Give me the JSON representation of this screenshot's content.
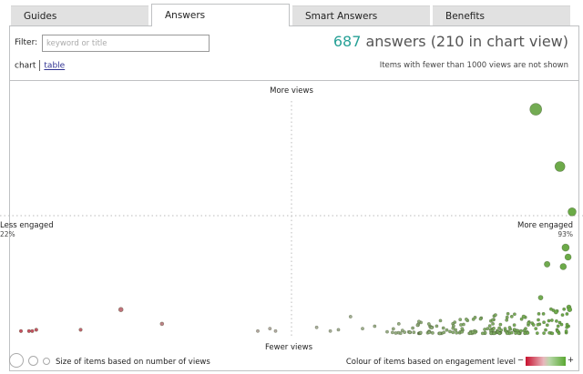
{
  "tabs": [
    {
      "label": "Guides",
      "active": false
    },
    {
      "label": "Answers",
      "active": true
    },
    {
      "label": "Smart Answers",
      "active": false
    },
    {
      "label": "Benefits",
      "active": false
    }
  ],
  "filter": {
    "label": "Filter:",
    "placeholder": "keyword or title",
    "value": ""
  },
  "summary": {
    "count": "687",
    "text": " answers (210 in chart view)"
  },
  "view_toggle": {
    "current": "chart",
    "other": "table"
  },
  "note": "Items with fewer than 1000 views are not shown",
  "axes": {
    "top": "More views",
    "bottom": "Fewer views",
    "left": "Less engaged",
    "left_value": "22%",
    "right": "More engaged",
    "right_value": "93%"
  },
  "legend": {
    "size_text": "Size of items based on number of views",
    "colour_text": "Colour of items based on engagement level",
    "minus": "−",
    "plus": "+"
  },
  "colors": {
    "accent": "#28a197",
    "low_engagement": "#c8102e",
    "high_engagement": "#5aa832",
    "link": "#2e3191"
  },
  "chart_data": {
    "type": "scatter",
    "x_label_left": "Less engaged",
    "x_label_right": "More engaged",
    "y_label_top": "More views",
    "y_label_bottom": "Fewer views",
    "xlim_percent": [
      22,
      93
    ],
    "points": [
      {
        "engagement": 88.5,
        "views": 95,
        "r": 6.5
      },
      {
        "engagement": 91.5,
        "views": 71,
        "r": 5.5
      },
      {
        "engagement": 93.0,
        "views": 52,
        "r": 4.5
      },
      {
        "engagement": 92.2,
        "views": 37,
        "r": 4.0
      },
      {
        "engagement": 92.5,
        "views": 33,
        "r": 3.5
      },
      {
        "engagement": 91.9,
        "views": 29,
        "r": 3.5
      },
      {
        "engagement": 89.9,
        "views": 30,
        "r": 3.2
      },
      {
        "engagement": 89.1,
        "views": 16,
        "r": 2.6
      },
      {
        "engagement": 37.0,
        "views": 11,
        "r": 2.5
      },
      {
        "engagement": 92.6,
        "views": 12,
        "r": 2.5
      },
      {
        "engagement": 92.7,
        "views": 11,
        "r": 2.5
      },
      {
        "engagement": 91.0,
        "views": 10,
        "r": 2.3
      },
      {
        "engagement": 87.0,
        "views": 8,
        "r": 2.0
      },
      {
        "engagement": 42.1,
        "views": 5,
        "r": 2.0
      },
      {
        "engagement": 24.6,
        "views": 2,
        "r": 1.8
      },
      {
        "engagement": 25.6,
        "views": 2,
        "r": 1.8
      },
      {
        "engagement": 26.0,
        "views": 2,
        "r": 1.8
      },
      {
        "engagement": 26.5,
        "views": 2.5,
        "r": 1.8
      },
      {
        "engagement": 32.0,
        "views": 2.5,
        "r": 1.8
      },
      {
        "engagement": 54.0,
        "views": 2,
        "r": 1.6
      },
      {
        "engagement": 55.5,
        "views": 3,
        "r": 1.6
      },
      {
        "engagement": 56.2,
        "views": 2,
        "r": 1.6
      },
      {
        "engagement": 61.3,
        "views": 3.5,
        "r": 1.6
      },
      {
        "engagement": 63.0,
        "views": 2,
        "r": 1.6
      },
      {
        "engagement": 64.0,
        "views": 2.5,
        "r": 1.6
      },
      {
        "engagement": 65.5,
        "views": 8,
        "r": 1.6
      },
      {
        "engagement": 67.0,
        "views": 3,
        "r": 1.6
      },
      {
        "engagement": 68.5,
        "views": 4,
        "r": 1.6
      },
      {
        "engagement": 71.5,
        "views": 5,
        "r": 1.6
      },
      {
        "engagement": 74.0,
        "views": 6,
        "r": 1.6
      }
    ],
    "dense_cluster": {
      "engagement_range": [
        70,
        93
      ],
      "views_range": [
        1,
        9
      ],
      "count": 180
    }
  }
}
